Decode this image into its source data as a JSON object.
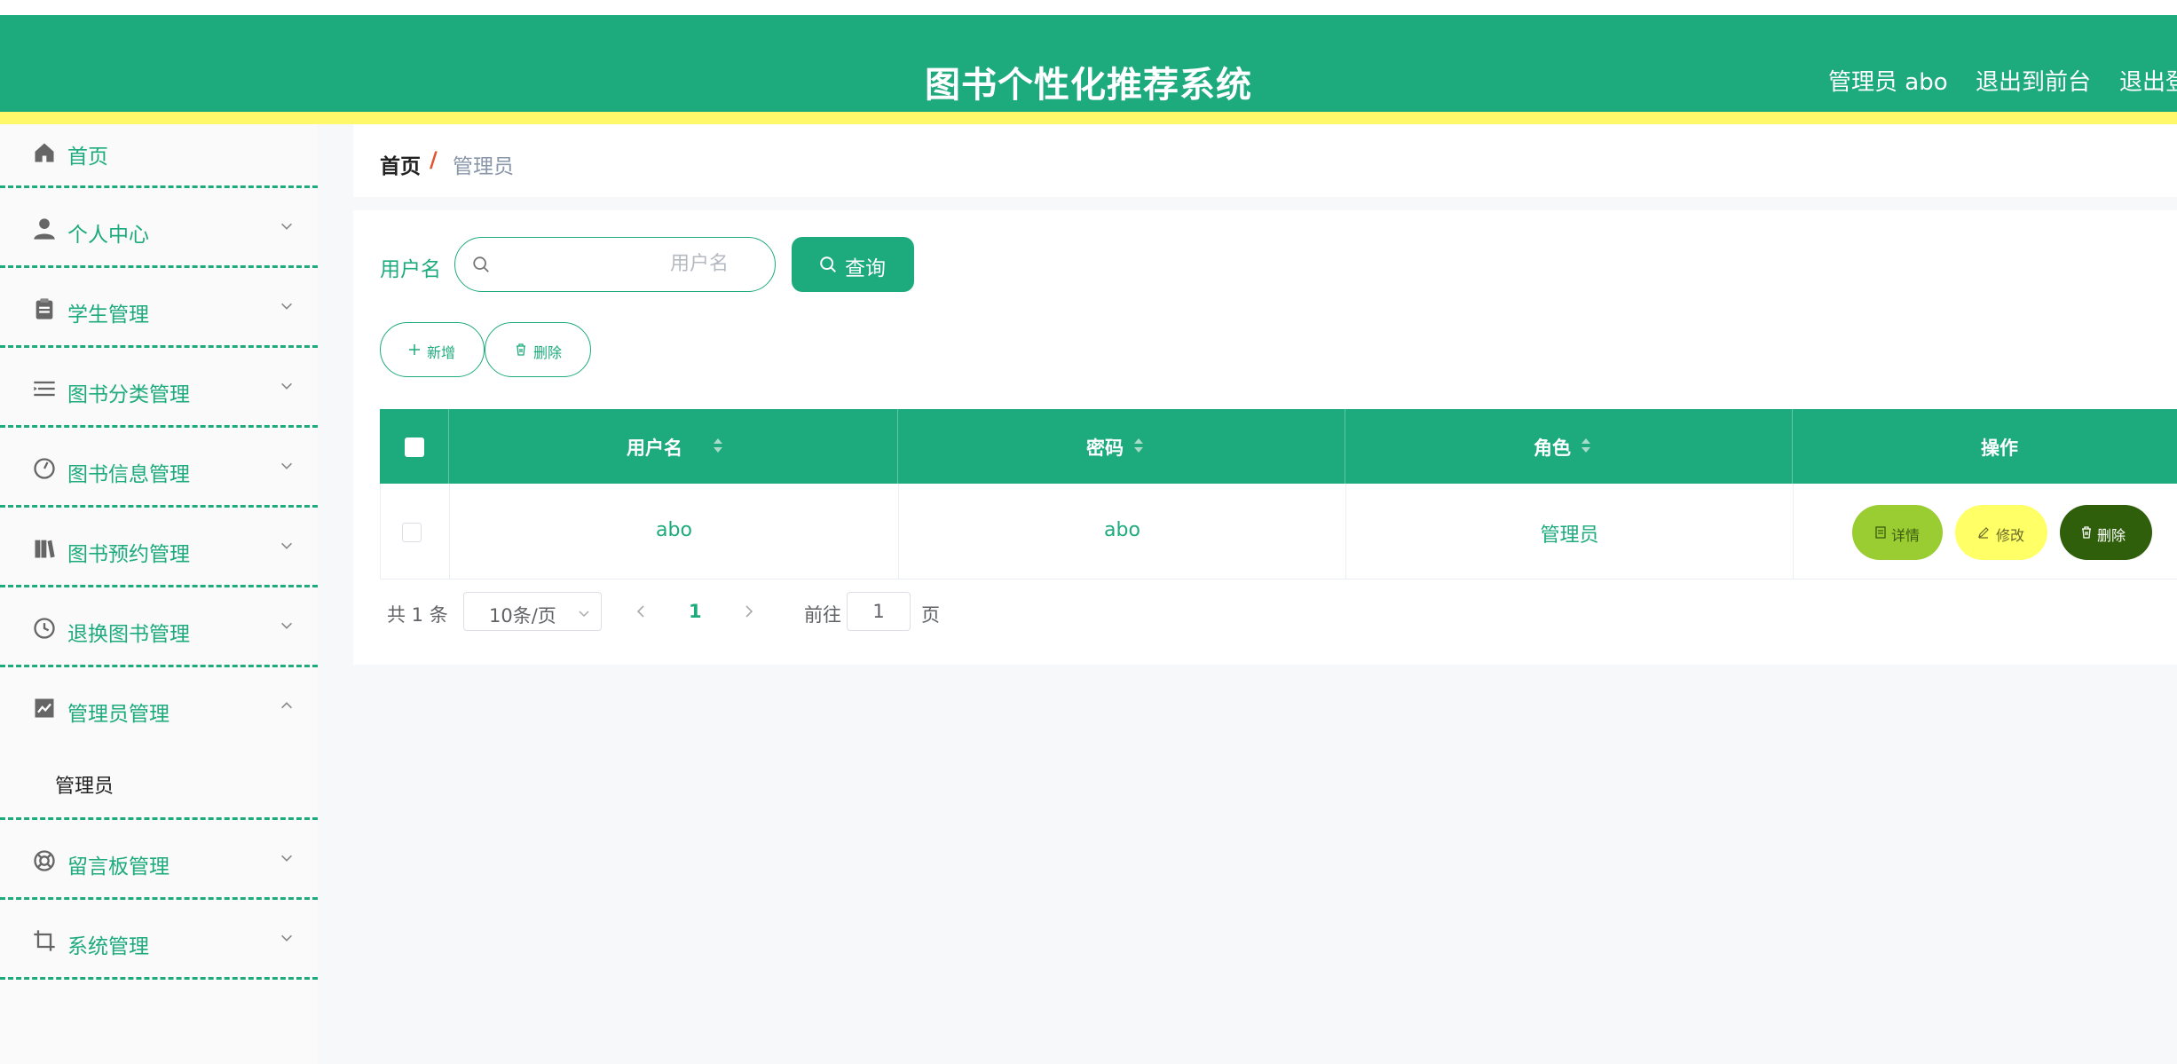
{
  "header": {
    "title": "图书个性化推荐系统",
    "user_label": "管理员 abo",
    "to_front_label": "退出到前台",
    "logout_label": "退出登"
  },
  "sidebar": {
    "items": [
      {
        "label": "首页",
        "icon": "home-icon"
      },
      {
        "label": "个人中心",
        "icon": "user-icon"
      },
      {
        "label": "学生管理",
        "icon": "clipboard-icon"
      },
      {
        "label": "图书分类管理",
        "icon": "list-icon"
      },
      {
        "label": "图书信息管理",
        "icon": "gauge-icon"
      },
      {
        "label": "图书预约管理",
        "icon": "books-icon"
      },
      {
        "label": "退换图书管理",
        "icon": "clock-icon"
      },
      {
        "label": "管理员管理",
        "icon": "chart-icon",
        "expanded": true,
        "children": [
          "管理员"
        ]
      },
      {
        "label": "留言板管理",
        "icon": "lifebuoy-icon"
      },
      {
        "label": "系统管理",
        "icon": "crop-icon"
      }
    ]
  },
  "breadcrumb": {
    "home": "首页",
    "separator": "/",
    "current": "管理员"
  },
  "search": {
    "label": "用户名",
    "placeholder": "用户名",
    "query_label": "查询"
  },
  "actions": {
    "add_label": "新增",
    "delete_label": "删除"
  },
  "table": {
    "columns": [
      "用户名",
      "密码",
      "角色",
      "操作"
    ],
    "rows": [
      {
        "username": "abo",
        "password": "abo",
        "role": "管理员"
      }
    ],
    "row_actions": {
      "detail": "详情",
      "edit": "修改",
      "delete": "删除"
    }
  },
  "pager": {
    "total": "共 1 条",
    "page_size": "10条/页",
    "current_page": "1",
    "goto_label": "前往",
    "goto_value": "1",
    "page_suffix": "页"
  },
  "colors": {
    "primary": "#1daa7c",
    "yellow_strip": "#fff86b",
    "detail_btn": "#9acd32",
    "edit_btn": "#ffff66",
    "delete_btn": "#2f5f0a"
  }
}
